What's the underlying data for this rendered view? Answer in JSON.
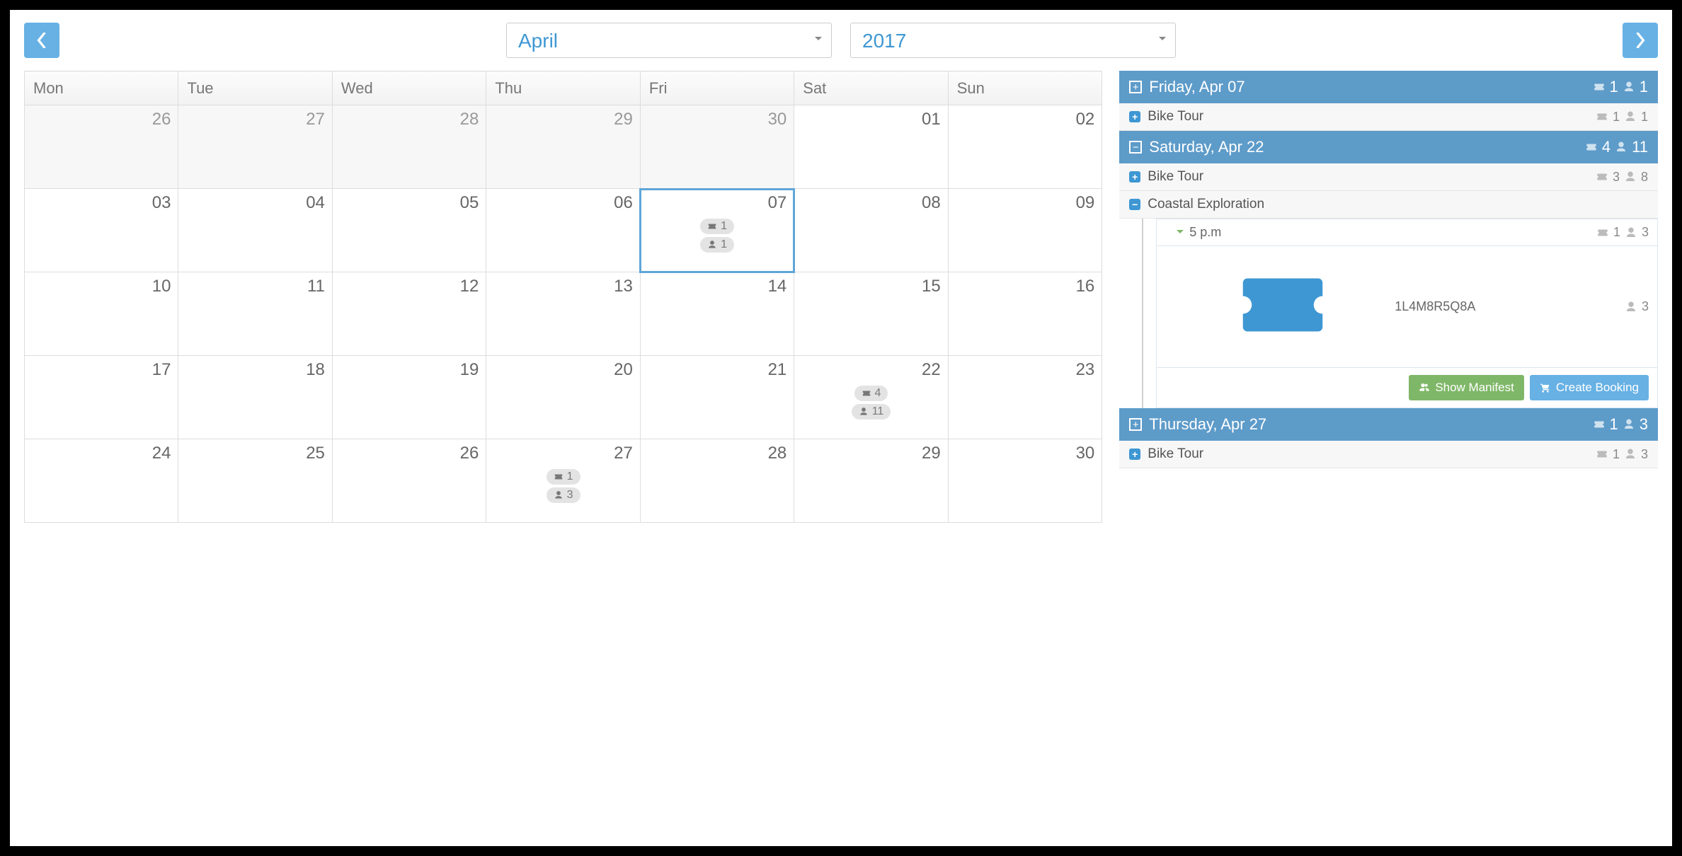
{
  "nav": {
    "month": "April",
    "year": "2017"
  },
  "weekdays": [
    "Mon",
    "Tue",
    "Wed",
    "Thu",
    "Fri",
    "Sat",
    "Sun"
  ],
  "weeks": [
    [
      {
        "n": "26",
        "other": true
      },
      {
        "n": "27",
        "other": true
      },
      {
        "n": "28",
        "other": true
      },
      {
        "n": "29",
        "other": true
      },
      {
        "n": "30",
        "other": true
      },
      {
        "n": "01"
      },
      {
        "n": "02"
      }
    ],
    [
      {
        "n": "03"
      },
      {
        "n": "04"
      },
      {
        "n": "05"
      },
      {
        "n": "06"
      },
      {
        "n": "07",
        "selected": true,
        "tickets": "1",
        "people": "1"
      },
      {
        "n": "08"
      },
      {
        "n": "09"
      }
    ],
    [
      {
        "n": "10"
      },
      {
        "n": "11"
      },
      {
        "n": "12"
      },
      {
        "n": "13"
      },
      {
        "n": "14"
      },
      {
        "n": "15"
      },
      {
        "n": "16"
      }
    ],
    [
      {
        "n": "17"
      },
      {
        "n": "18"
      },
      {
        "n": "19"
      },
      {
        "n": "20"
      },
      {
        "n": "21"
      },
      {
        "n": "22",
        "tickets": "4",
        "people": "11"
      },
      {
        "n": "23"
      }
    ],
    [
      {
        "n": "24"
      },
      {
        "n": "25"
      },
      {
        "n": "26"
      },
      {
        "n": "27",
        "tickets": "1",
        "people": "3"
      },
      {
        "n": "28"
      },
      {
        "n": "29"
      },
      {
        "n": "30"
      }
    ]
  ],
  "groups": [
    {
      "title": "Friday, Apr 07",
      "expanded": false,
      "tickets": "1",
      "people": "1",
      "items": [
        {
          "type": "tour",
          "expanded": false,
          "label": "Bike Tour",
          "tickets": "1",
          "people": "1"
        }
      ]
    },
    {
      "title": "Saturday, Apr 22",
      "expanded": true,
      "tickets": "4",
      "people": "11",
      "items": [
        {
          "type": "tour",
          "expanded": false,
          "label": "Bike Tour",
          "tickets": "3",
          "people": "8"
        },
        {
          "type": "tour",
          "expanded": true,
          "label": "Coastal Exploration",
          "slots": [
            {
              "time": "5 p.m",
              "tickets": "1",
              "people": "3",
              "bookings": [
                {
                  "code": "1L4M8R5Q8A",
                  "people": "3"
                }
              ]
            }
          ]
        }
      ]
    },
    {
      "title": "Thursday, Apr 27",
      "expanded": false,
      "tickets": "1",
      "people": "3",
      "items": [
        {
          "type": "tour",
          "expanded": false,
          "label": "Bike Tour",
          "tickets": "1",
          "people": "3"
        }
      ]
    }
  ],
  "buttons": {
    "manifest": "Show Manifest",
    "create": "Create Booking"
  }
}
